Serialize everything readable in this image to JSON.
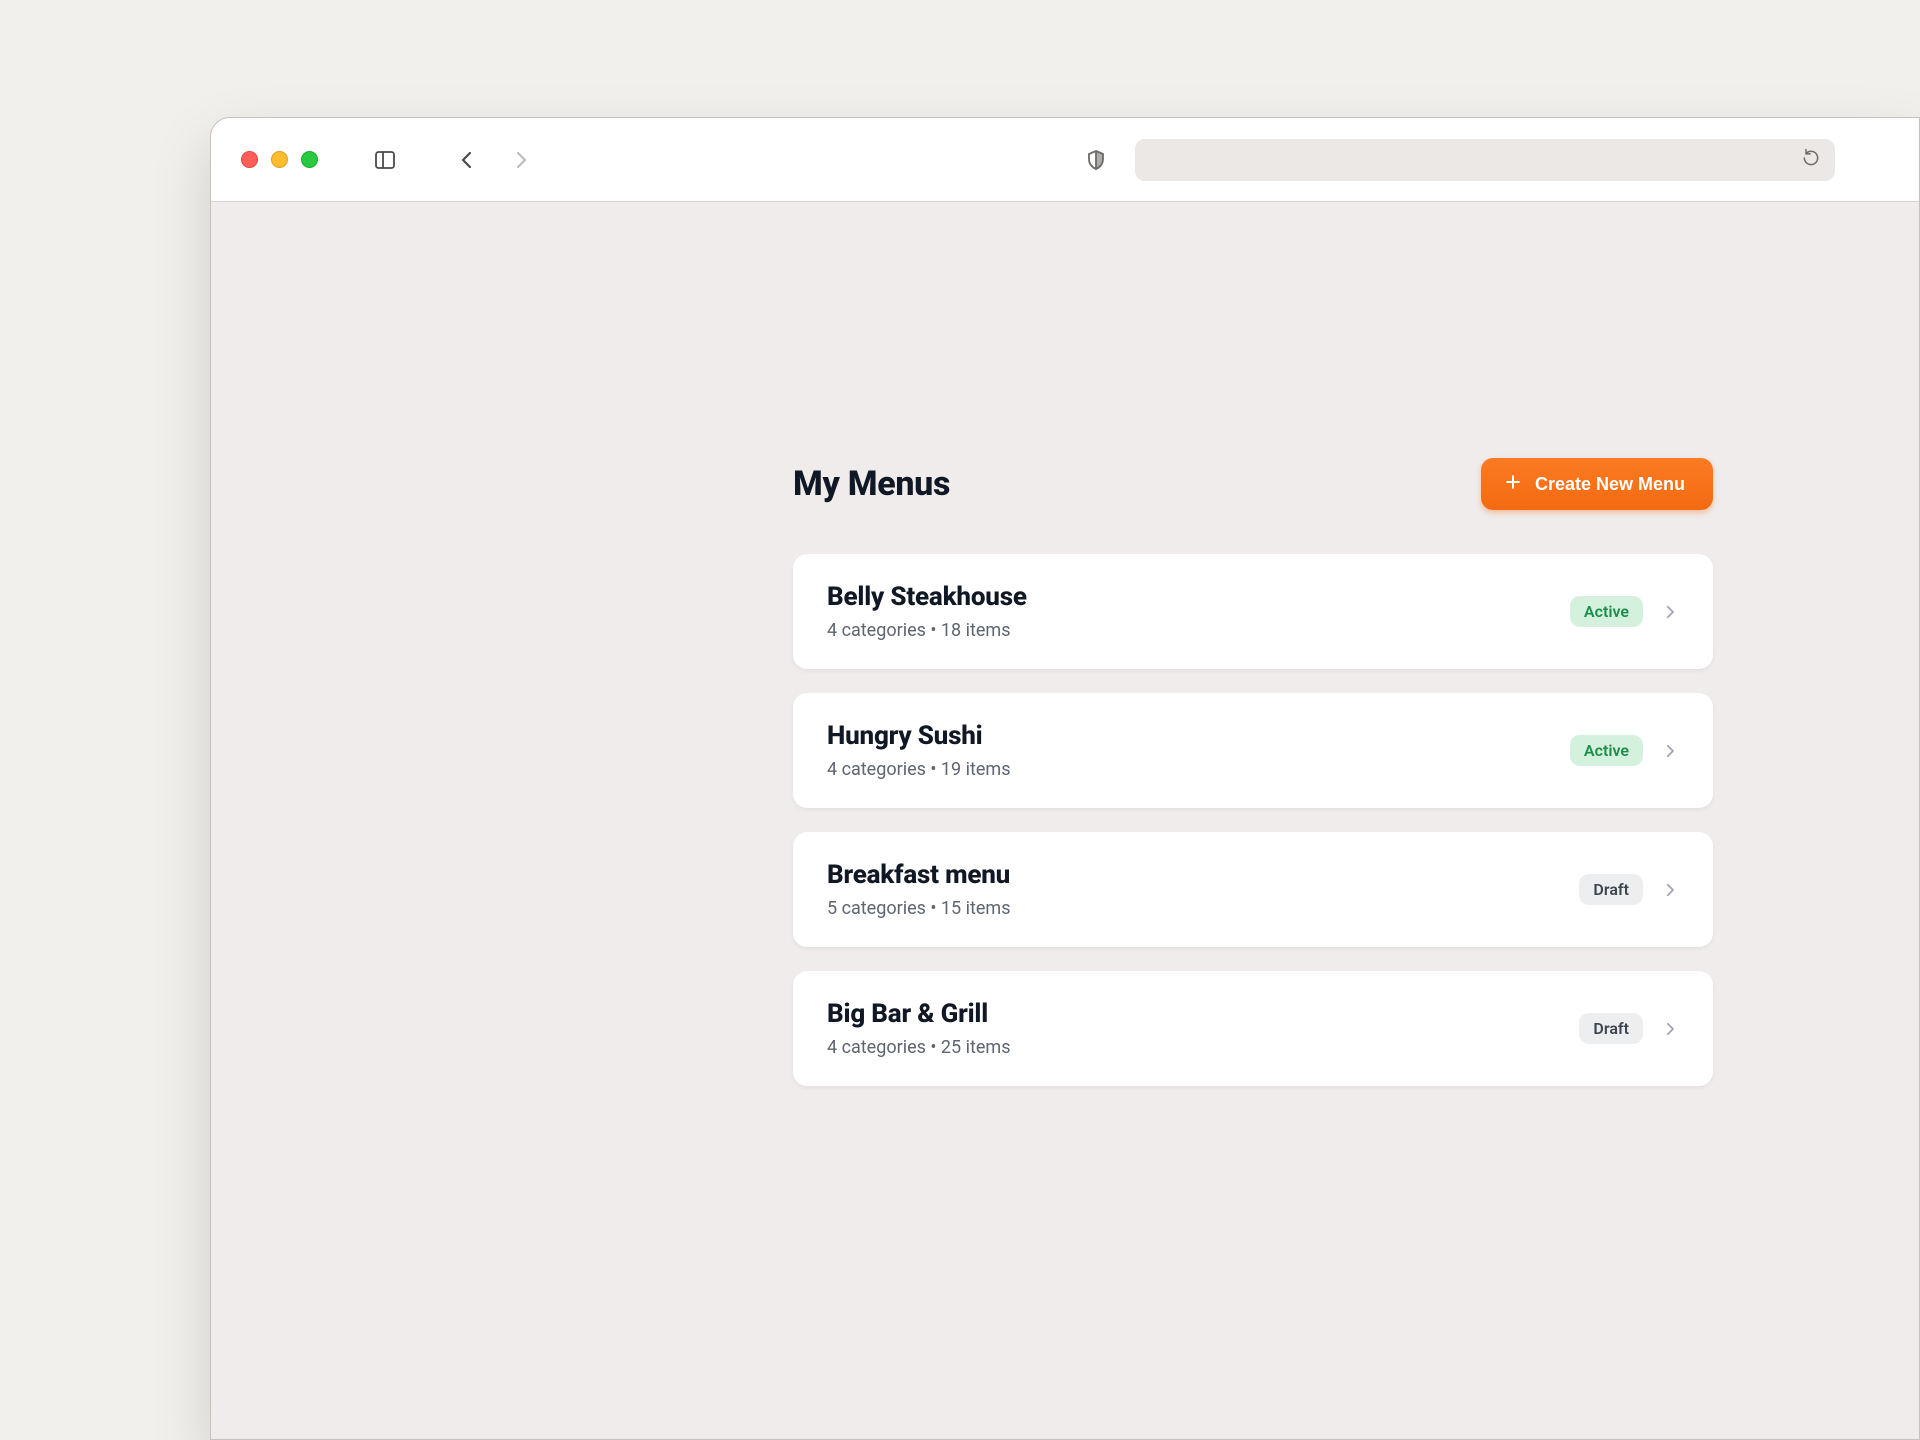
{
  "browser": {
    "url": "",
    "traffic_lights": [
      "close",
      "minimize",
      "zoom"
    ]
  },
  "header": {
    "title": "My Menus",
    "create_button_label": "Create New Menu"
  },
  "status_labels": {
    "active": "Active",
    "draft": "Draft"
  },
  "menus": [
    {
      "name": "Belly Steakhouse",
      "subtitle": "4 categories • 18 items",
      "status": "active"
    },
    {
      "name": "Hungry Sushi",
      "subtitle": "4 categories • 19 items",
      "status": "active"
    },
    {
      "name": "Breakfast menu",
      "subtitle": "5 categories • 15 items",
      "status": "draft"
    },
    {
      "name": "Big Bar & Grill",
      "subtitle": "4 categories • 25 items",
      "status": "draft"
    }
  ]
}
